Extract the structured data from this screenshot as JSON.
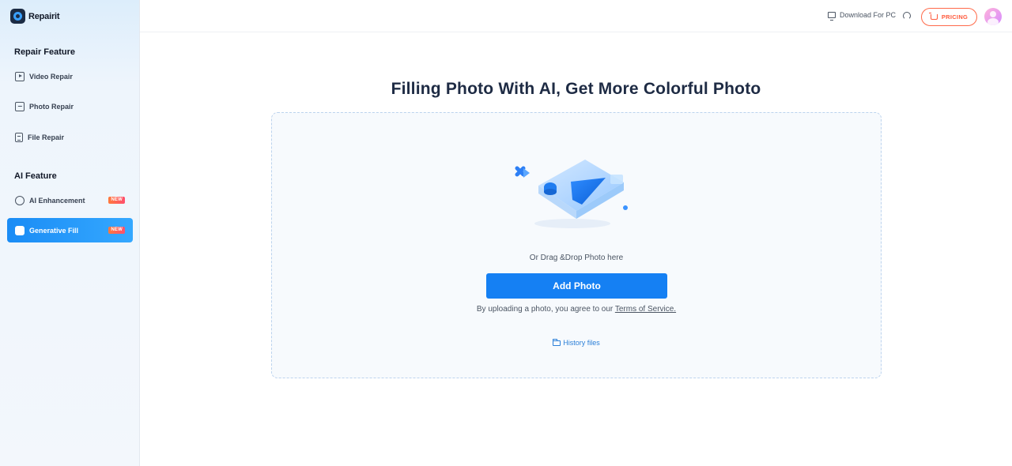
{
  "app": {
    "name": "Repairit"
  },
  "sidebar": {
    "repair_section_title": "Repair Feature",
    "repair_items": [
      {
        "label": "Video Repair",
        "icon": "video-icon"
      },
      {
        "label": "Photo Repair",
        "icon": "photo-icon"
      },
      {
        "label": "File Repair",
        "icon": "file-icon"
      }
    ],
    "ai_section_title": "AI Feature",
    "ai_items": [
      {
        "label": "AI Enhancement",
        "icon": "ai-icon",
        "badge": "NEW",
        "active": false
      },
      {
        "label": "Generative Fill",
        "icon": "generative-fill-icon",
        "badge": "NEW",
        "active": true
      }
    ]
  },
  "topbar": {
    "download_label": "Download For PC",
    "pricing_label": "PRICING"
  },
  "main": {
    "title": "Filling Photo With AI, Get More Colorful Photo",
    "drop_hint": "Or Drag &Drop Photo here",
    "add_button_label": "Add Photo",
    "terms_prefix": "By uploading a photo, you agree to our ",
    "terms_link": "Terms of Service.",
    "history_label": "History files"
  },
  "colors": {
    "accent": "#1580f3",
    "pricing": "#ff5a3c",
    "badge": "#ff4f6d",
    "title": "#1e2b44"
  }
}
